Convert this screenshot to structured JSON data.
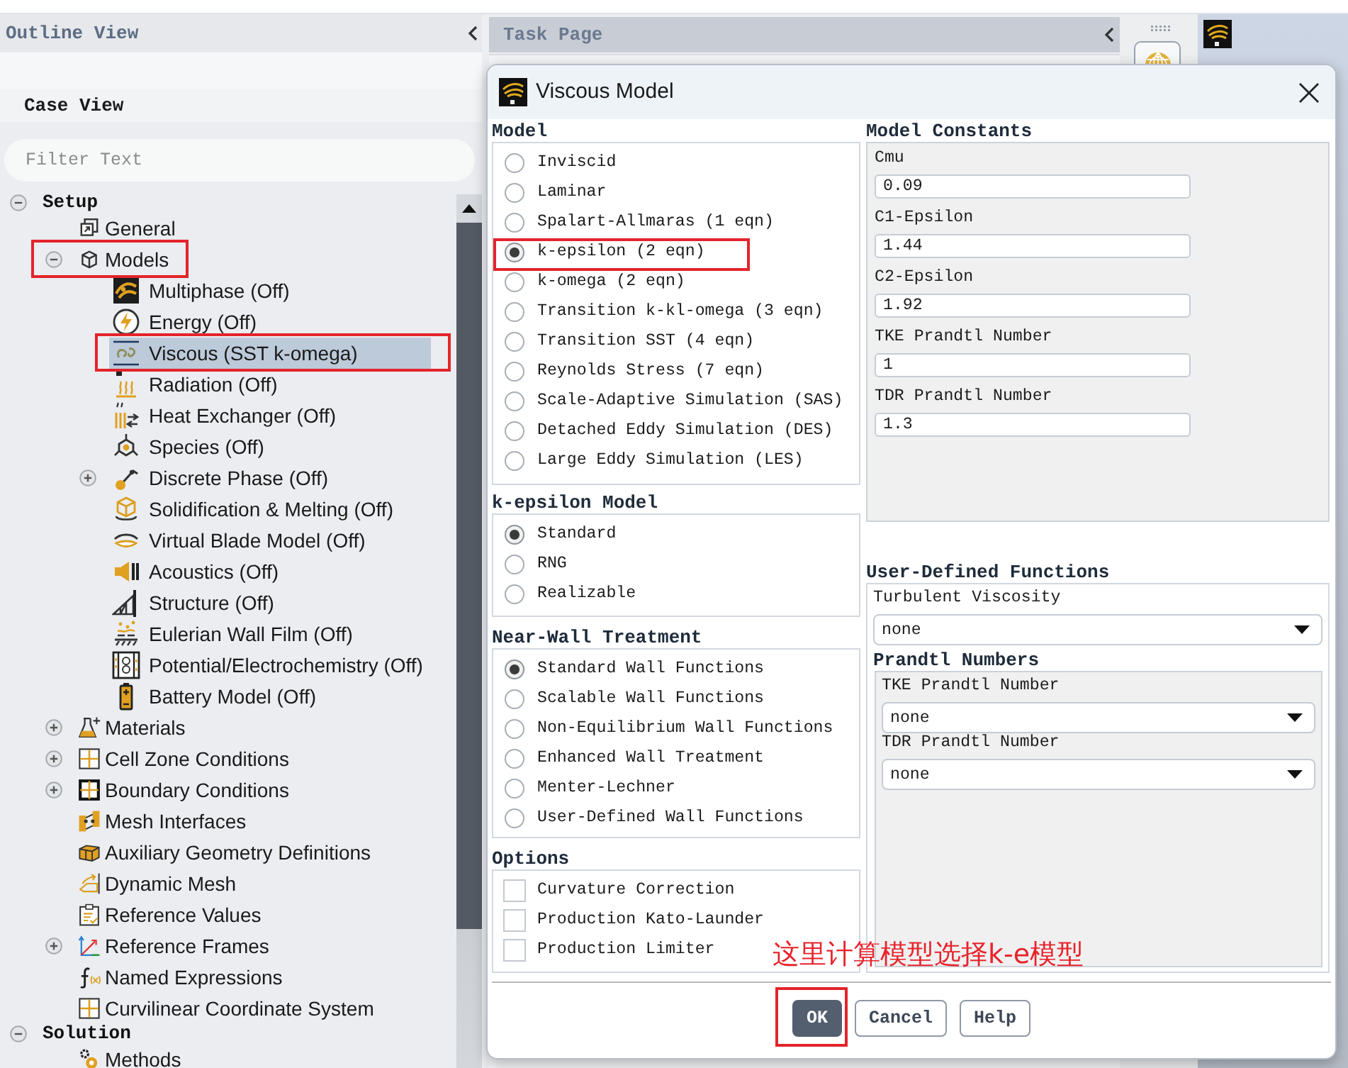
{
  "outline_view": {
    "title": "Outline View",
    "case_view": {
      "title": "Case View"
    },
    "filter": {
      "placeholder": "Filter Text"
    },
    "tree": [
      {
        "label": "Setup",
        "expanded": true,
        "selected": false,
        "annotated": false,
        "children": [
          {
            "label": "General",
            "selected": false,
            "annotated": false
          },
          {
            "label": "Models",
            "expanded": true,
            "selected": false,
            "annotated": true,
            "children": [
              {
                "label": "Multiphase (Off)",
                "selected": false,
                "annotated": false
              },
              {
                "label": "Energy (Off)",
                "selected": false,
                "annotated": false
              },
              {
                "label": "Viscous (SST k-omega)",
                "selected": true,
                "annotated": true
              },
              {
                "label": "Radiation (Off)",
                "selected": false,
                "annotated": false
              },
              {
                "label": "Heat Exchanger (Off)",
                "selected": false,
                "annotated": false
              },
              {
                "label": "Species (Off)",
                "selected": false,
                "annotated": false
              },
              {
                "label": "Discrete Phase (Off)",
                "expanded": false,
                "selected": false,
                "annotated": false
              },
              {
                "label": "Solidification & Melting (Off)",
                "selected": false,
                "annotated": false
              },
              {
                "label": "Virtual Blade Model (Off)",
                "selected": false,
                "annotated": false
              },
              {
                "label": "Acoustics (Off)",
                "selected": false,
                "annotated": false
              },
              {
                "label": "Structure (Off)",
                "selected": false,
                "annotated": false
              },
              {
                "label": "Eulerian Wall Film (Off)",
                "selected": false,
                "annotated": false
              },
              {
                "label": "Potential/Electrochemistry (Off)",
                "selected": false,
                "annotated": false
              },
              {
                "label": "Battery Model (Off)",
                "selected": false,
                "annotated": false
              }
            ]
          },
          {
            "label": "Materials",
            "expanded": false,
            "selected": false,
            "annotated": false
          },
          {
            "label": "Cell Zone Conditions",
            "expanded": false,
            "selected": false,
            "annotated": false
          },
          {
            "label": "Boundary Conditions",
            "expanded": false,
            "selected": false,
            "annotated": false
          },
          {
            "label": "Mesh Interfaces",
            "selected": false,
            "annotated": false
          },
          {
            "label": "Auxiliary Geometry Definitions",
            "selected": false,
            "annotated": false
          },
          {
            "label": "Dynamic Mesh",
            "selected": false,
            "annotated": false
          },
          {
            "label": "Reference Values",
            "selected": false,
            "annotated": false
          },
          {
            "label": "Reference Frames",
            "expanded": false,
            "selected": false,
            "annotated": false
          },
          {
            "label": "Named Expressions",
            "selected": false,
            "annotated": false
          },
          {
            "label": "Curvilinear Coordinate System",
            "selected": false,
            "annotated": false
          }
        ]
      },
      {
        "label": "Solution",
        "expanded": true,
        "selected": false,
        "annotated": false,
        "children": [
          {
            "label": "Methods",
            "selected": false,
            "annotated": false
          }
        ]
      }
    ]
  },
  "task_page": {
    "title": "Task Page"
  },
  "dialog": {
    "title": "Viscous Model",
    "model": {
      "label": "Model",
      "options": [
        {
          "label": "Inviscid",
          "selected": false,
          "annotated": false
        },
        {
          "label": "Laminar",
          "selected": false,
          "annotated": false
        },
        {
          "label": "Spalart-Allmaras (1 eqn)",
          "selected": false,
          "annotated": false
        },
        {
          "label": "k-epsilon (2 eqn)",
          "selected": true,
          "annotated": true
        },
        {
          "label": "k-omega (2 eqn)",
          "selected": false,
          "annotated": false
        },
        {
          "label": "Transition k-kl-omega (3 eqn)",
          "selected": false,
          "annotated": false
        },
        {
          "label": "Transition SST (4 eqn)",
          "selected": false,
          "annotated": false
        },
        {
          "label": "Reynolds Stress (7 eqn)",
          "selected": false,
          "annotated": false
        },
        {
          "label": "Scale-Adaptive Simulation (SAS)",
          "selected": false,
          "annotated": false
        },
        {
          "label": "Detached Eddy Simulation (DES)",
          "selected": false,
          "annotated": false
        },
        {
          "label": "Large Eddy Simulation (LES)",
          "selected": false,
          "annotated": false
        }
      ]
    },
    "k_epsilon_model": {
      "label": "k-epsilon Model",
      "options": [
        {
          "label": "Standard",
          "selected": true
        },
        {
          "label": "RNG",
          "selected": false
        },
        {
          "label": "Realizable",
          "selected": false
        }
      ]
    },
    "near_wall_treatment": {
      "label": "Near-Wall Treatment",
      "options": [
        {
          "label": "Standard Wall Functions",
          "selected": true
        },
        {
          "label": "Scalable Wall Functions",
          "selected": false
        },
        {
          "label": "Non-Equilibrium Wall Functions",
          "selected": false
        },
        {
          "label": "Enhanced Wall Treatment",
          "selected": false
        },
        {
          "label": "Menter-Lechner",
          "selected": false
        },
        {
          "label": "User-Defined Wall Functions",
          "selected": false
        }
      ]
    },
    "options": {
      "label": "Options",
      "items": [
        {
          "label": "Curvature Correction",
          "checked": false
        },
        {
          "label": "Production Kato-Launder",
          "checked": false
        },
        {
          "label": "Production Limiter",
          "checked": false
        }
      ]
    },
    "model_constants": {
      "label": "Model Constants",
      "fields": [
        {
          "label": "Cmu",
          "value": "0.09"
        },
        {
          "label": "C1-Epsilon",
          "value": "1.44"
        },
        {
          "label": "C2-Epsilon",
          "value": "1.92"
        },
        {
          "label": "TKE Prandtl Number",
          "value": "1"
        },
        {
          "label": "TDR Prandtl Number",
          "value": "1.3"
        }
      ]
    },
    "user_defined_functions": {
      "label": "User-Defined Functions",
      "turbulent_viscosity": {
        "label": "Turbulent Viscosity",
        "value": "none"
      },
      "prandtl_numbers": {
        "label": "Prandtl Numbers",
        "fields": [
          {
            "label": "TKE Prandtl Number",
            "value": "none"
          },
          {
            "label": "TDR Prandtl Number",
            "value": "none"
          }
        ]
      }
    },
    "annotation": {
      "text": "这里计算模型选择k-e模型"
    },
    "buttons": [
      {
        "label": "OK",
        "default": true,
        "annotated": true
      },
      {
        "label": "Cancel",
        "default": false,
        "annotated": false
      },
      {
        "label": "Help",
        "default": false,
        "annotated": false
      }
    ]
  }
}
